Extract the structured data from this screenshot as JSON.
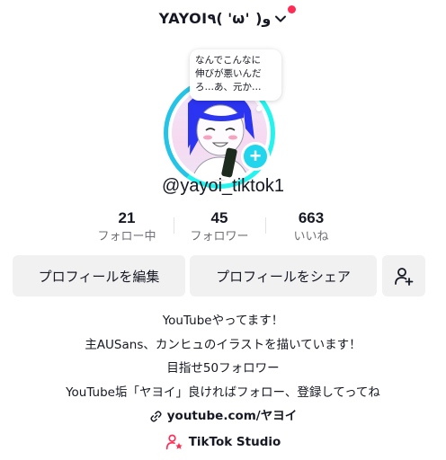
{
  "header": {
    "display_name": "YAYOI٩( 'ω' )و",
    "notification_color": "#fe2c55"
  },
  "bubble": {
    "text": "なんでこんなに\n伸びが悪いんだ\nろ…あ、元か…"
  },
  "profile": {
    "handle": "@yayoi_tiktok1",
    "accent_color": "#20d5ec"
  },
  "stats": [
    {
      "value": "21",
      "label": "フォロー中"
    },
    {
      "value": "45",
      "label": "フォロワー"
    },
    {
      "value": "663",
      "label": "いいね"
    }
  ],
  "buttons": {
    "edit_label": "プロフィールを編集",
    "share_label": "プロフィールをシェア",
    "add_friend_icon": "add-person-icon"
  },
  "bio": {
    "lines": [
      "YouTubeやってます！",
      "主AUSans、カンヒュのイラストを描いています！",
      "目指せ50フォロワー",
      "YouTube垢「ヤヨイ」良ければフォロー、登録してってね"
    ],
    "link": "youtube.com/ヤヨイ"
  },
  "studio": {
    "label": "TikTok Studio",
    "icon_color": "#fe2c55"
  }
}
